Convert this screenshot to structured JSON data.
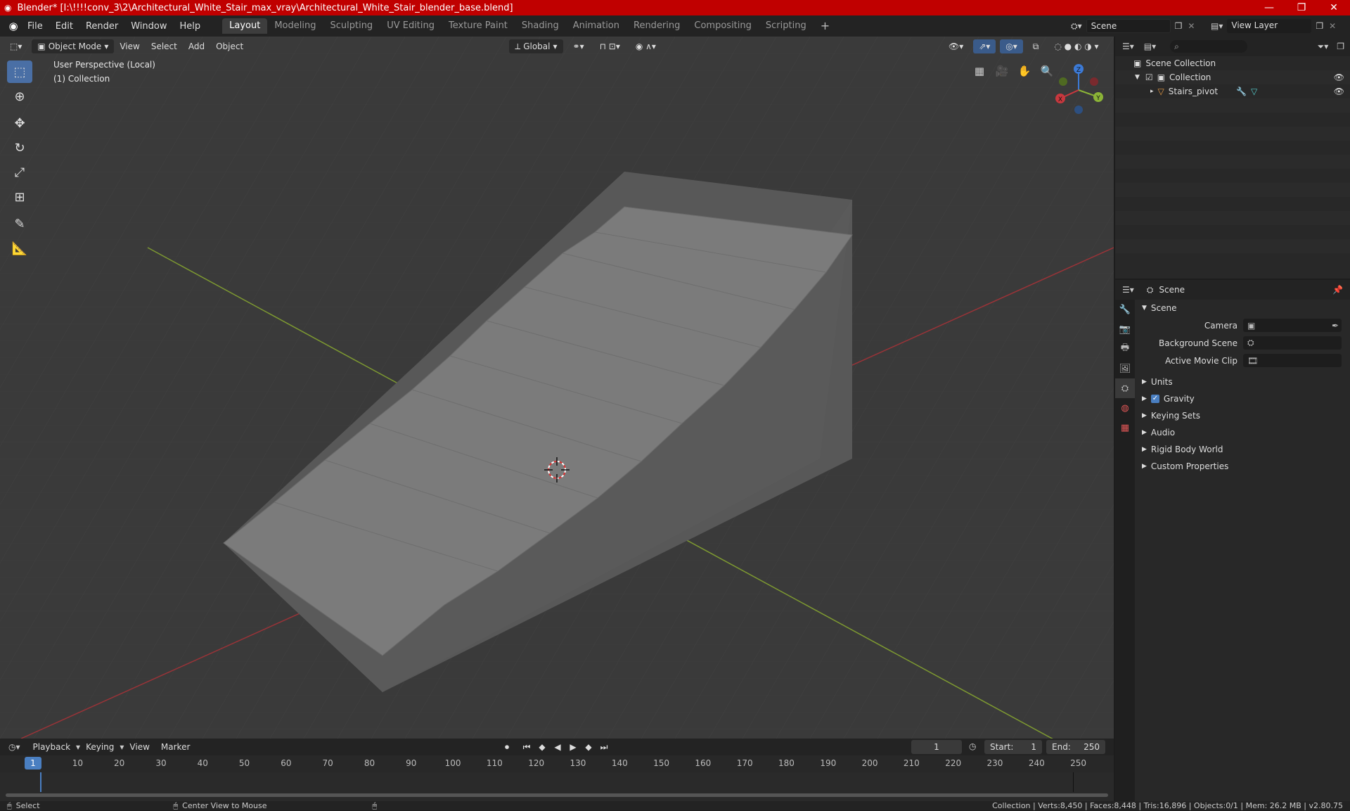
{
  "window": {
    "title": "Blender* [I:\\!!!!conv_3\\2\\Architectural_White_Stair_max_vray\\Architectural_White_Stair_blender_base.blend]"
  },
  "menu": [
    "File",
    "Edit",
    "Render",
    "Window",
    "Help"
  ],
  "workspaces": [
    "Layout",
    "Modeling",
    "Sculpting",
    "UV Editing",
    "Texture Paint",
    "Shading",
    "Animation",
    "Rendering",
    "Compositing",
    "Scripting"
  ],
  "workspace_add": "+",
  "scene": {
    "name": "Scene"
  },
  "viewlayer": {
    "name": "View Layer"
  },
  "viewport": {
    "mode": "Object Mode",
    "menus": [
      "View",
      "Select",
      "Add",
      "Object"
    ],
    "transform_orientation": "Global",
    "info_line1": "User Perspective (Local)",
    "info_line2": "(1) Collection"
  },
  "gizmo": {
    "z": "Z",
    "y": "Y",
    "x": "X"
  },
  "outliner": {
    "root": "Scene Collection",
    "collection": "Collection",
    "object": "Stairs_pivot"
  },
  "properties": {
    "header": "Scene",
    "section": "Scene",
    "fields": [
      {
        "label": "Camera"
      },
      {
        "label": "Background Scene"
      },
      {
        "label": "Active Movie Clip"
      }
    ],
    "panels": [
      "Units",
      "Gravity",
      "Keying Sets",
      "Audio",
      "Rigid Body World",
      "Custom Properties"
    ]
  },
  "timeline": {
    "menus": [
      "Playback",
      "Keying",
      "View",
      "Marker"
    ],
    "current_frame": "1",
    "start_label": "Start:",
    "start": "1",
    "end_label": "End:",
    "end": "250",
    "ticks": [
      "10",
      "20",
      "30",
      "40",
      "50",
      "60",
      "70",
      "80",
      "90",
      "100",
      "110",
      "120",
      "130",
      "140",
      "150",
      "160",
      "170",
      "180",
      "190",
      "200",
      "210",
      "220",
      "230",
      "240",
      "250"
    ]
  },
  "status": {
    "left1": "Select",
    "left2": "Center View to Mouse",
    "stats": "Collection | Verts:8,450 | Faces:8,448 | Tris:16,896 | Objects:0/1 | Mem: 26.2 MB | v2.80.75"
  },
  "colors": {
    "accent": "#4a7fc1",
    "titlebar": "#c00000",
    "x_axis": "#c8383e",
    "y_axis": "#8bb337",
    "z_axis": "#3c7ad6"
  }
}
